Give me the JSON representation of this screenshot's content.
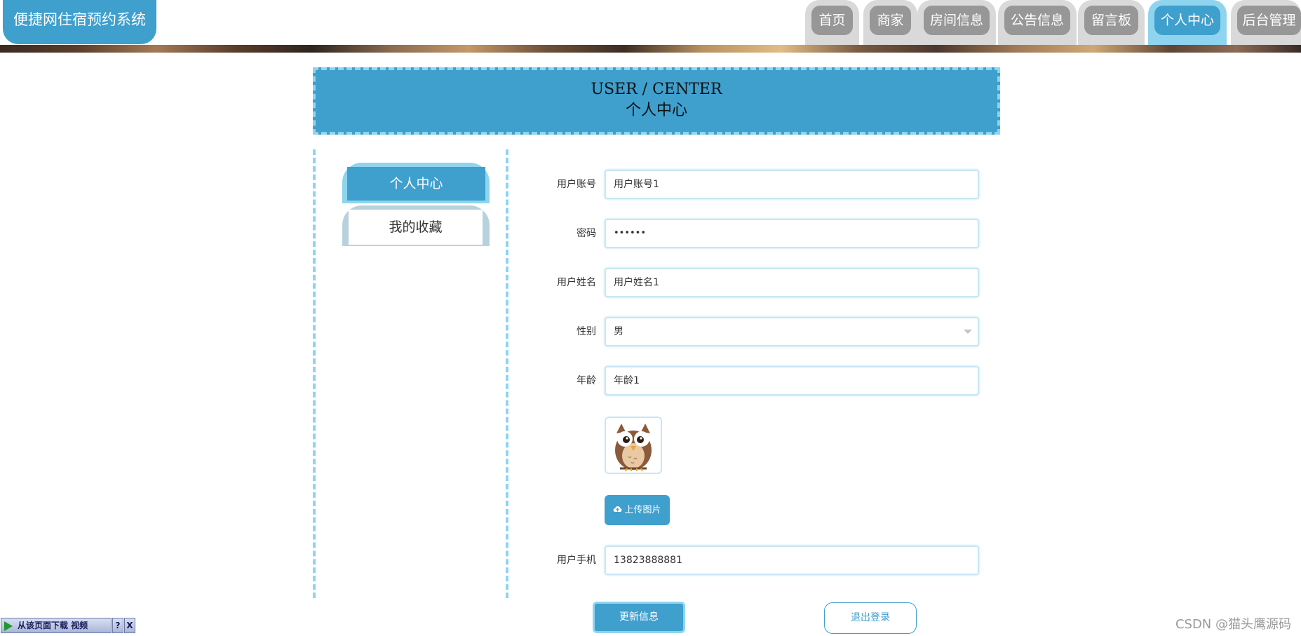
{
  "header": {
    "logo_text": "便捷网住宿预约系统",
    "nav_items": [
      {
        "label": "首页",
        "active": false
      },
      {
        "label": "商家",
        "active": false
      },
      {
        "label": "房间信息",
        "active": false
      },
      {
        "label": "公告信息",
        "active": false
      },
      {
        "label": "留言板",
        "active": false
      },
      {
        "label": "个人中心",
        "active": true
      },
      {
        "label": "后台管理",
        "active": false
      }
    ]
  },
  "title_box": {
    "title_en": "USER / CENTER",
    "title_zh": "个人中心"
  },
  "sidebar": {
    "items": [
      {
        "label": "个人中心",
        "active": true
      },
      {
        "label": "我的收藏",
        "active": false
      }
    ]
  },
  "form": {
    "account": {
      "label": "用户账号",
      "value": "用户账号1"
    },
    "password": {
      "label": "密码",
      "value": "••••••"
    },
    "name": {
      "label": "用户姓名",
      "value": "用户姓名1"
    },
    "gender": {
      "label": "性别",
      "value": "男"
    },
    "age": {
      "label": "年龄",
      "value": "年龄1"
    },
    "avatar_icon": "owl-avatar",
    "upload_label": "上传图片",
    "phone": {
      "label": "用户手机",
      "value": "13823888881"
    }
  },
  "actions": {
    "update_label": "更新信息",
    "logout_label": "退出登录"
  },
  "download_bar": {
    "label": "从该页面下载 视频",
    "help": "?",
    "close": "X"
  },
  "watermark": "CSDN @猫头鹰源码",
  "colors": {
    "accent": "#3f9fcd",
    "accent_light": "#8fd4ef",
    "nav_inactive": "#979797"
  }
}
